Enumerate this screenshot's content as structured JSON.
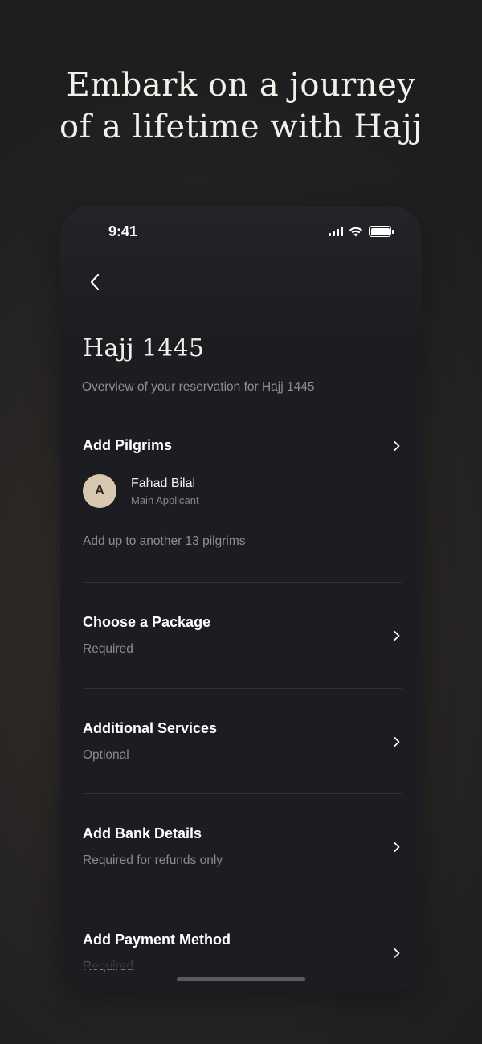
{
  "headline": {
    "line1": "Embark on a journey",
    "line2": "of a lifetime with Hajj"
  },
  "status_bar": {
    "time": "9:41",
    "icons": [
      "signal-icon",
      "wifi-icon",
      "battery-icon"
    ]
  },
  "page": {
    "back_icon": "chevron-left-icon",
    "title": "Hajj 1445",
    "subtitle": "Overview of your reservation for Hajj 1445"
  },
  "pilgrims": {
    "title": "Add Pilgrims",
    "applicant": {
      "initial": "A",
      "name": "Fahad Bilal",
      "role": "Main Applicant"
    },
    "add_more": "Add up to another 13 pilgrims"
  },
  "steps": [
    {
      "title": "Choose a Package",
      "subtitle": "Required"
    },
    {
      "title": "Additional Services",
      "subtitle": "Optional"
    },
    {
      "title": "Add Bank Details",
      "subtitle": "Required for refunds only"
    },
    {
      "title": "Add Payment Method",
      "subtitle": "Required"
    }
  ],
  "colors": {
    "background": "#2a2725",
    "card": "#1c1d20",
    "avatar": "#d8c8b0",
    "text_primary": "#ffffff",
    "text_secondary": "#8a8b8f"
  }
}
